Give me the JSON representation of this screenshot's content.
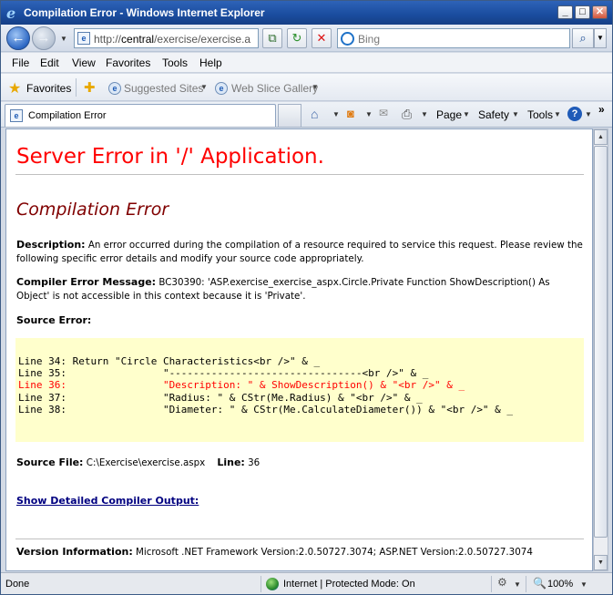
{
  "window": {
    "title": "Compilation Error - Windows Internet Explorer",
    "min": "_",
    "max": "□",
    "close": "✕"
  },
  "address_bar": {
    "url_prefix": "http://",
    "url_host": "central",
    "url_path": "/exercise/exercise.a",
    "search_placeholder": "Bing"
  },
  "menu": {
    "items": [
      "File",
      "Edit",
      "View",
      "Favorites",
      "Tools",
      "Help"
    ]
  },
  "favorites_bar": {
    "label": "Favorites",
    "items": [
      "Suggested Sites",
      "Web Slice Gallery"
    ]
  },
  "tabs": [
    {
      "title": "Compilation Error"
    }
  ],
  "command_bar": {
    "items": [
      "Page",
      "Safety",
      "Tools"
    ]
  },
  "page": {
    "heading": "Server Error in '/' Application.",
    "subheading": "Compilation Error",
    "description_label": "Description:",
    "description_text": "An error occurred during the compilation of a resource required to service this request. Please review the following specific error details and modify your source code appropriately.",
    "compiler_msg_label": "Compiler Error Message:",
    "compiler_msg_text": "BC30390: 'ASP.exercise_exercise_aspx.Circle.Private Function ShowDescription() As Object' is not accessible in this context because it is 'Private'.",
    "source_error_label": "Source Error:",
    "code_lines": [
      {
        "text": "Line 34: Return \"Circle Characteristics<br />\" & _",
        "error": false
      },
      {
        "text": "Line 35:                \"--------------------------------<br />\" & _",
        "error": false
      },
      {
        "text": "Line 36:                \"Description: \" & ShowDescription() & \"<br />\" & _",
        "error": true
      },
      {
        "text": "Line 37:                \"Radius: \" & CStr(Me.Radius) & \"<br />\" & _",
        "error": false
      },
      {
        "text": "Line 38:                \"Diameter: \" & CStr(Me.CalculateDiameter()) & \"<br />\" & _",
        "error": false
      }
    ],
    "source_file_label": "Source File:",
    "source_file_value": "C:\\Exercise\\exercise.aspx",
    "line_label": "Line:",
    "line_value": "36",
    "detail_link": "Show Detailed Compiler Output:",
    "version_label": "Version Information:",
    "version_text": "Microsoft .NET Framework Version:2.0.50727.3074; ASP.NET Version:2.0.50727.3074"
  },
  "status_bar": {
    "text": "Done",
    "zone": "Internet | Protected Mode: On",
    "zoom": "100%"
  },
  "colors": {
    "error_red": "#ff0000",
    "subheading_maroon": "#800000",
    "code_background": "#ffffcc",
    "link_navy": "#000080",
    "titlebar_blue": "#1a4c9e"
  },
  "icons": [
    "ie-logo-icon",
    "back-icon",
    "forward-icon",
    "page-icon",
    "compat-view-icon",
    "refresh-icon",
    "stop-icon",
    "bing-icon",
    "search-icon",
    "favorites-star-icon",
    "add-favorites-icon",
    "home-icon",
    "rss-feed-icon",
    "read-mail-icon",
    "print-icon",
    "help-icon",
    "globe-icon",
    "zoom-icon"
  ]
}
